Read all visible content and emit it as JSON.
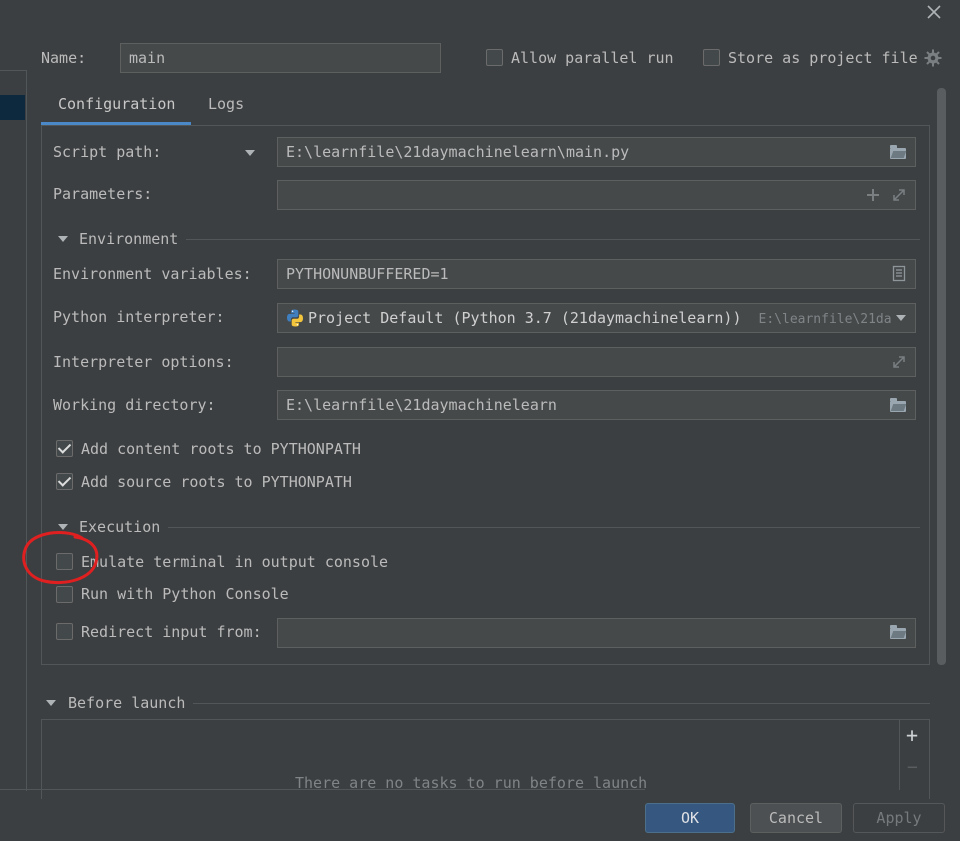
{
  "header": {
    "name_label": "Name:",
    "name_value": "main",
    "allow_parallel_label": "Allow parallel run",
    "store_project_label": "Store as project file"
  },
  "tabs": [
    {
      "label": "Configuration",
      "active": true
    },
    {
      "label": "Logs",
      "active": false
    }
  ],
  "config": {
    "script_path_label": "Script path:",
    "script_path_value": "E:\\learnfile\\21daymachinelearn\\main.py",
    "parameters_label": "Parameters:",
    "parameters_value": "",
    "environment_section": "Environment",
    "env_vars_label": "Environment variables:",
    "env_vars_value": "PYTHONUNBUFFERED=1",
    "interpreter_label": "Python interpreter:",
    "interpreter_value": "Project Default (Python 3.7 (21daymachinelearn))",
    "interpreter_path": "E:\\learnfile\\21da",
    "interp_options_label": "Interpreter options:",
    "interp_options_value": "",
    "working_dir_label": "Working directory:",
    "working_dir_value": "E:\\learnfile\\21daymachinelearn",
    "add_content_roots_label": "Add content roots to PYTHONPATH",
    "add_source_roots_label": "Add source roots to PYTHONPATH",
    "execution_section": "Execution",
    "emulate_terminal_label": "Emulate terminal in output console",
    "run_with_console_label": "Run with Python Console",
    "redirect_input_label": "Redirect input from:",
    "redirect_input_value": ""
  },
  "before_launch": {
    "section": "Before launch",
    "empty_text": "There are no tasks to run before launch",
    "add_symbol": "+",
    "remove_symbol": "−"
  },
  "footer": {
    "ok_label": "OK",
    "cancel_label": "Cancel",
    "apply_label": "Apply"
  },
  "colors": {
    "background": "#3c3f41",
    "accent_tab_underline": "#4a88c7",
    "primary_button": "#365880",
    "annotation_red": "#e02020"
  }
}
